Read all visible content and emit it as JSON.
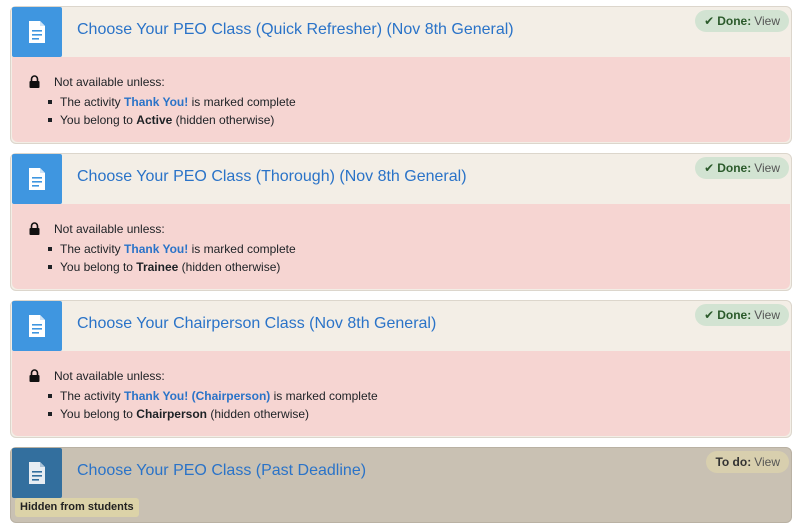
{
  "activities": [
    {
      "title": "Choose Your PEO Class (Quick Refresher) (Nov 8th General)",
      "status_label": "Done:",
      "status_action": "View",
      "restriction_heading": "Not available unless:",
      "cond1_pre": "The activity ",
      "cond1_link": "Thank You!",
      "cond1_post": " is marked complete",
      "cond2_pre": "You belong to ",
      "cond2_group": "Active",
      "cond2_post": " (hidden otherwise)"
    },
    {
      "title": "Choose Your PEO Class (Thorough) (Nov 8th General)",
      "status_label": "Done:",
      "status_action": "View",
      "restriction_heading": "Not available unless:",
      "cond1_pre": "The activity ",
      "cond1_link": "Thank You!",
      "cond1_post": " is marked complete",
      "cond2_pre": "You belong to ",
      "cond2_group": "Trainee",
      "cond2_post": " (hidden otherwise)"
    },
    {
      "title": "Choose Your Chairperson Class (Nov 8th General)",
      "status_label": "Done:",
      "status_action": "View",
      "restriction_heading": "Not available unless:",
      "cond1_pre": "The activity ",
      "cond1_link": "Thank You! (Chairperson)",
      "cond1_post": " is marked complete",
      "cond2_pre": "You belong to ",
      "cond2_group": "Chairperson",
      "cond2_post": " (hidden otherwise)"
    },
    {
      "title": "Choose Your PEO Class (Past Deadline)",
      "status_label": "To do:",
      "status_action": "View",
      "badge": "Hidden from students"
    }
  ],
  "icons": {
    "activity": "page-icon",
    "lock": "lock-icon",
    "done": "check-icon"
  },
  "colors": {
    "accent": "#3f96e0",
    "link": "#2a73c8",
    "restriction_bg": "#f6d5d2",
    "done_bg": "#d2e3d2",
    "hidden_bg": "#c9c1b3"
  }
}
